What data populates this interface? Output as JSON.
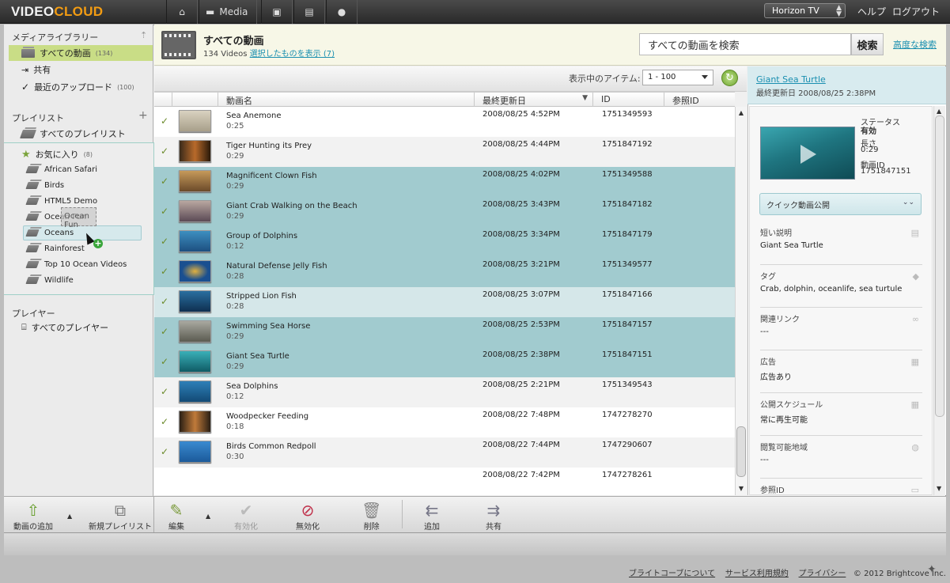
{
  "brand": {
    "logo_video": "VIDEO",
    "logo_cloud": "CLOUD"
  },
  "topnav": {
    "media_label": "Media",
    "account": "Horizon TV",
    "help": "ヘルプ",
    "logout": "ログアウト"
  },
  "sidebar": {
    "library_heading": "メディアライブラリー",
    "library_items": [
      {
        "label": "すべての動画",
        "count": "(134)"
      },
      {
        "label": "共有",
        "count": ""
      },
      {
        "label": "最近のアップロード",
        "count": "(100)"
      }
    ],
    "playlist_heading": "プレイリスト",
    "all_playlists": "すべてのプレイリスト",
    "favorites": {
      "label": "お気に入り",
      "count": "(8)"
    },
    "playlists": [
      "African Safari",
      "Birds",
      "HTML5 Demo",
      "Ocean Fun",
      "Oceans",
      "Rainforest",
      "Top 10 Ocean Videos",
      "Wildlife"
    ],
    "drag_label": "Ocean Fun",
    "player_heading": "プレイヤー",
    "all_players": "すべてのプレイヤー"
  },
  "header": {
    "title": "すべての動画",
    "count": "134 Videos",
    "show_selected": "選択したものを表示 (7)",
    "search_placeholder": "すべての動画を検索",
    "search_button": "検索",
    "advanced": "高度な検索"
  },
  "list": {
    "showing_label": "表示中のアイテム:",
    "range": "1 - 100",
    "columns": [
      "動画名",
      "最終更新日",
      "ID",
      "参照ID"
    ],
    "rows": [
      {
        "name": "Sea Anemone",
        "duration": "0:25",
        "date": "2008/08/25 4:52PM",
        "id": "1751349593"
      },
      {
        "name": "Tiger Hunting its Prey",
        "duration": "0:29",
        "date": "2008/08/25 4:44PM",
        "id": "1751847192"
      },
      {
        "name": "Magnificent Clown Fish",
        "duration": "0:29",
        "date": "2008/08/25 4:02PM",
        "id": "1751349588"
      },
      {
        "name": "Giant Crab Walking on the Beach",
        "duration": "0:29",
        "date": "2008/08/25 3:43PM",
        "id": "1751847182"
      },
      {
        "name": "Group of Dolphins",
        "duration": "0:12",
        "date": "2008/08/25 3:34PM",
        "id": "1751847179"
      },
      {
        "name": "Natural Defense Jelly Fish",
        "duration": "0:28",
        "date": "2008/08/25 3:21PM",
        "id": "1751349577"
      },
      {
        "name": "Stripped Lion Fish",
        "duration": "0:28",
        "date": "2008/08/25 3:07PM",
        "id": "1751847166"
      },
      {
        "name": "Swimming Sea Horse",
        "duration": "0:29",
        "date": "2008/08/25 2:53PM",
        "id": "1751847157"
      },
      {
        "name": "Giant Sea Turtle",
        "duration": "0:29",
        "date": "2008/08/25 2:38PM",
        "id": "1751847151"
      },
      {
        "name": "Sea Dolphins",
        "duration": "0:12",
        "date": "2008/08/25 2:21PM",
        "id": "1751349543"
      },
      {
        "name": "Woodpecker Feeding",
        "duration": "0:18",
        "date": "2008/08/22 7:48PM",
        "id": "1747278270"
      },
      {
        "name": "Birds Common Redpoll",
        "duration": "0:30",
        "date": "2008/08/22 7:44PM",
        "id": "1747290607"
      },
      {
        "name": "",
        "duration": "",
        "date": "2008/08/22 7:42PM",
        "id": "1747278261"
      }
    ]
  },
  "detail": {
    "title": "Giant Sea Turtle",
    "modified": "最終更新日 2008/08/25 2:38PM",
    "status_label": "ステータス",
    "status_value": "有効",
    "length_label": "長さ",
    "length_value": "0:29",
    "id_label": "動画ID",
    "id_value": "1751847151",
    "quick_publish": "クイック動画公開",
    "fields": [
      {
        "label": "短い説明",
        "value": "Giant Sea Turtle"
      },
      {
        "label": "タグ",
        "value": "Crab, dolphin, oceanlife, sea turtule"
      },
      {
        "label": "関連リンク",
        "value": "---"
      },
      {
        "label": "広告",
        "value": "広告あり"
      },
      {
        "label": "公開スケジュール",
        "value": "常に再生可能"
      },
      {
        "label": "閲覧可能地域",
        "value": "---"
      },
      {
        "label": "参照ID",
        "value": ""
      }
    ]
  },
  "toolbar": {
    "add_video": "動画の追加",
    "new_playlist": "新規プレイリスト",
    "edit": "編集",
    "enable": "有効化",
    "disable": "無効化",
    "delete": "削除",
    "add": "追加",
    "share": "共有"
  },
  "footer": {
    "about": "ブライトコーブについて",
    "terms": "サービス利用規約",
    "privacy": "プライバシー",
    "copyright": "© 2012 Brightcove Inc."
  }
}
